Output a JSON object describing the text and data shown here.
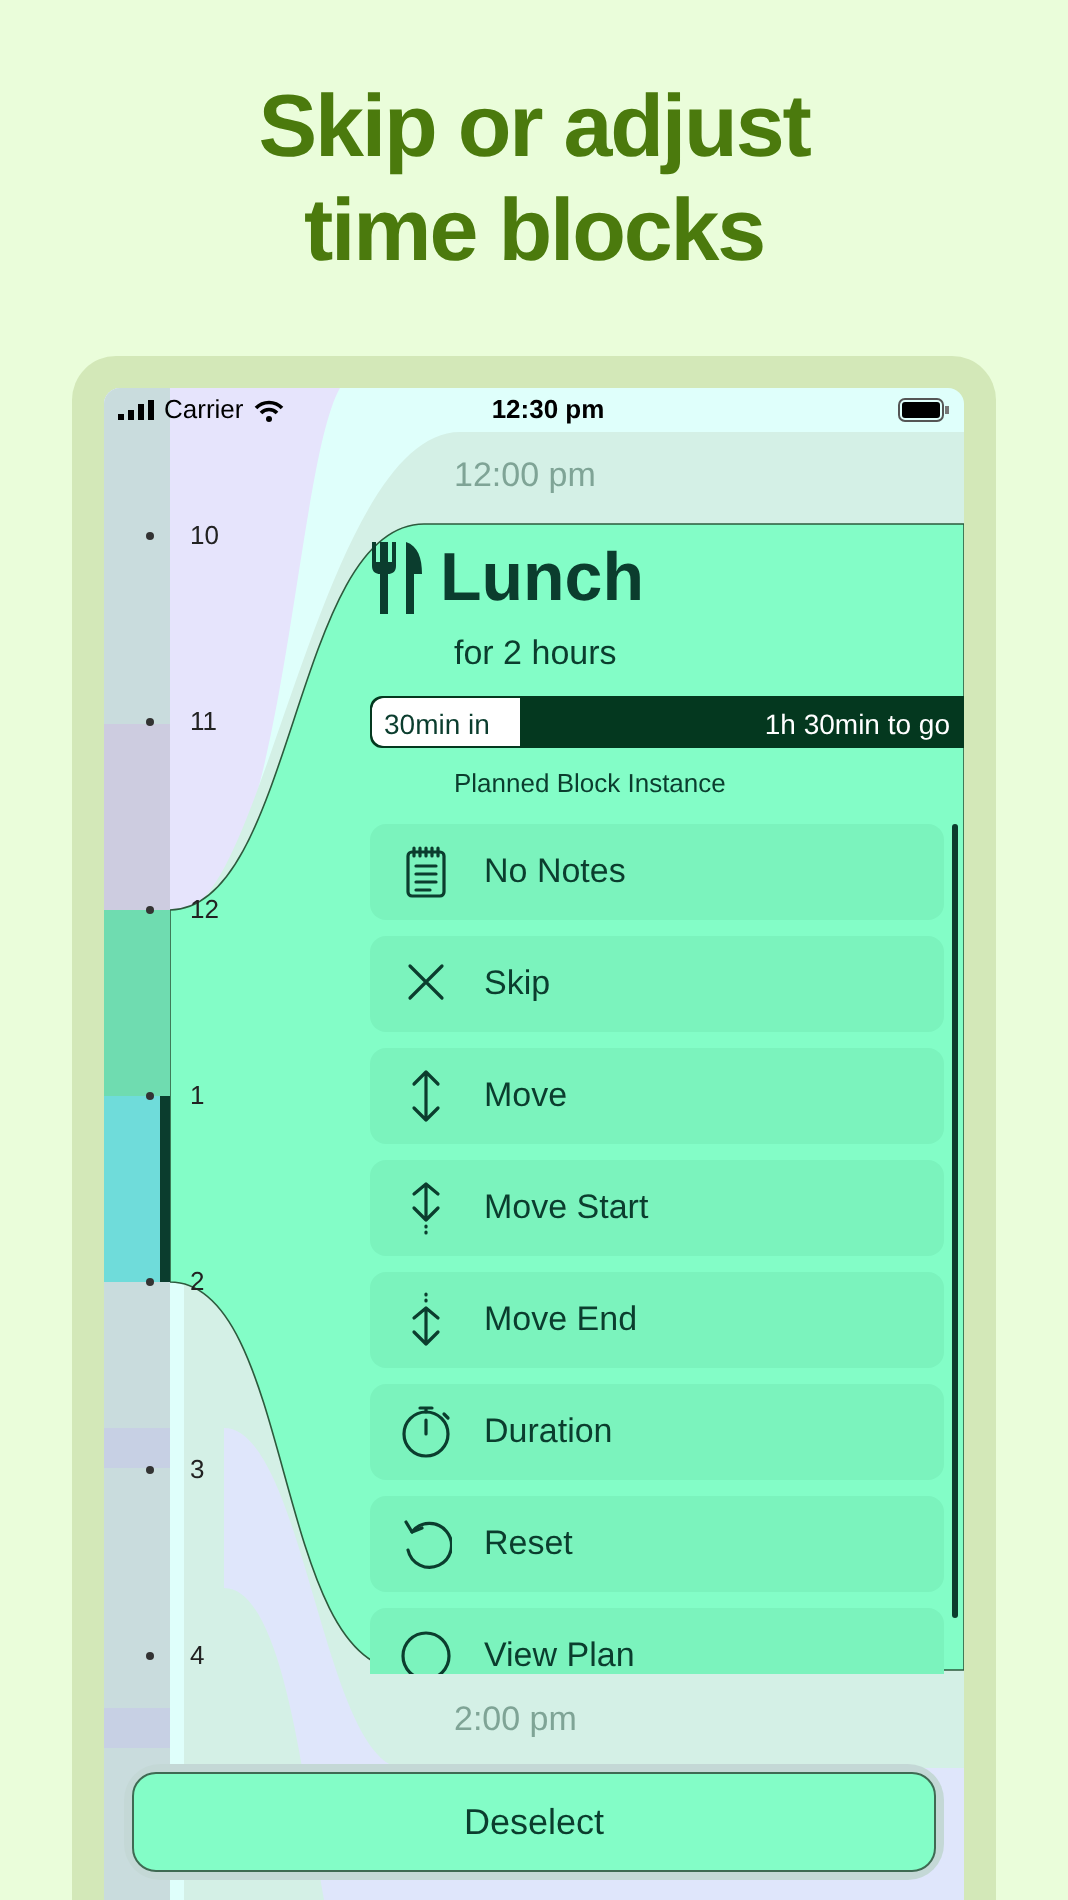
{
  "headline": "Skip or adjust time blocks",
  "status_bar": {
    "carrier": "Carrier",
    "time": "12:30 pm"
  },
  "timeline": {
    "hours": [
      "10",
      "11",
      "12",
      "1",
      "2",
      "3",
      "4"
    ],
    "markers": [
      "12:00 pm",
      "2:00 pm"
    ]
  },
  "block": {
    "title": "Lunch",
    "duration": "for 2 hours",
    "progress": {
      "elapsed": "30min in",
      "remaining": "1h 30min to go",
      "level": 0.25
    },
    "subtitle": "Planned Block Instance",
    "actions": [
      {
        "kind": "notes",
        "label": "No Notes"
      },
      {
        "kind": "skip",
        "label": "Skip"
      },
      {
        "kind": "move",
        "label": "Move"
      },
      {
        "kind": "move_start",
        "label": "Move Start"
      },
      {
        "kind": "move_end",
        "label": "Move End"
      },
      {
        "kind": "duration",
        "label": "Duration"
      },
      {
        "kind": "reset",
        "label": "Reset"
      },
      {
        "kind": "plan",
        "label": "View Plan"
      }
    ]
  },
  "deselect_button": "Deselect"
}
